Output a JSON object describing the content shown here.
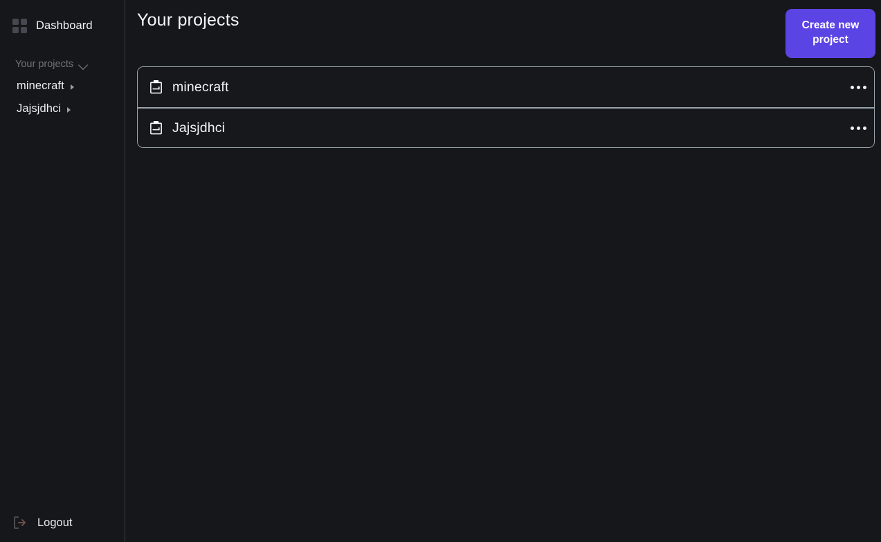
{
  "colors": {
    "background": "#16171a",
    "sidebar_background": "#16171a",
    "accent": "#5b44e4",
    "card_border": "#9aa3ad",
    "muted_text": "#6f737a",
    "primary_text": "#f2f3f6"
  },
  "sidebar": {
    "brand": {
      "label": "Dashboard",
      "icon": "grid-icon"
    },
    "section": {
      "label": "Your projects",
      "icon": "chevron-down-icon",
      "expanded": true
    },
    "projects": [
      {
        "name": "minecraft",
        "icon": "caret-right-icon"
      },
      {
        "name": "Jajsjdhci",
        "icon": "caret-right-icon"
      }
    ],
    "logout": {
      "label": "Logout",
      "icon": "logout-icon"
    }
  },
  "main": {
    "title": "Your projects",
    "create_button": {
      "label": "Create new project"
    },
    "projects": [
      {
        "name": "minecraft",
        "icon": "clipboard-icon",
        "menu": "kebab-menu-icon"
      },
      {
        "name": "Jajsjdhci",
        "icon": "clipboard-icon",
        "menu": "kebab-menu-icon"
      }
    ]
  }
}
